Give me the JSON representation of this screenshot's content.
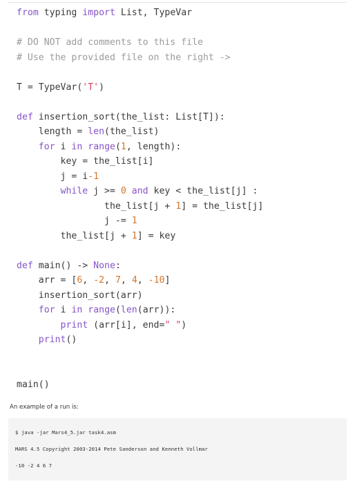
{
  "editor": {
    "language": "python",
    "colors": {
      "background": "#ffffff",
      "text": "#3a3a3a",
      "keyword": "#8554c8",
      "builtin": "#8554c8",
      "string": "#d93b59",
      "number": "#d2752a",
      "comment": "#9b9b9b",
      "rule": "#e3e3e3"
    },
    "lines": [
      [
        {
          "t": "from",
          "c": "kw"
        },
        {
          "t": " typing ",
          "c": "pl"
        },
        {
          "t": "import",
          "c": "kw"
        },
        {
          "t": " List, TypeVar",
          "c": "pl"
        }
      ],
      [],
      [
        {
          "t": "# DO NOT add comments to this file",
          "c": "com"
        }
      ],
      [
        {
          "t": "# Use the provided file on the right ->",
          "c": "com"
        }
      ],
      [],
      [
        {
          "t": "T = TypeVar(",
          "c": "pl"
        },
        {
          "t": "'T'",
          "c": "str"
        },
        {
          "t": ")",
          "c": "pl"
        }
      ],
      [],
      [
        {
          "t": "def",
          "c": "kw"
        },
        {
          "t": " insertion_sort(the_list: List[T]):",
          "c": "pl"
        }
      ],
      [
        {
          "t": "    length = ",
          "c": "pl"
        },
        {
          "t": "len",
          "c": "bi"
        },
        {
          "t": "(the_list)",
          "c": "pl"
        }
      ],
      [
        {
          "t": "    ",
          "c": "pl"
        },
        {
          "t": "for",
          "c": "kw"
        },
        {
          "t": " i ",
          "c": "pl"
        },
        {
          "t": "in",
          "c": "kw"
        },
        {
          "t": " ",
          "c": "pl"
        },
        {
          "t": "range",
          "c": "bi"
        },
        {
          "t": "(",
          "c": "pl"
        },
        {
          "t": "1",
          "c": "num"
        },
        {
          "t": ", length):",
          "c": "pl"
        }
      ],
      [
        {
          "t": "        key = the_list[i]",
          "c": "pl"
        }
      ],
      [
        {
          "t": "        j = i",
          "c": "pl"
        },
        {
          "t": "-1",
          "c": "num"
        }
      ],
      [
        {
          "t": "        ",
          "c": "pl"
        },
        {
          "t": "while",
          "c": "kw"
        },
        {
          "t": " j >= ",
          "c": "pl"
        },
        {
          "t": "0",
          "c": "num"
        },
        {
          "t": " ",
          "c": "pl"
        },
        {
          "t": "and",
          "c": "kw"
        },
        {
          "t": " key < the_list[j] :",
          "c": "pl"
        }
      ],
      [
        {
          "t": "                the_list[j + ",
          "c": "pl"
        },
        {
          "t": "1",
          "c": "num"
        },
        {
          "t": "] = the_list[j]",
          "c": "pl"
        }
      ],
      [
        {
          "t": "                j -= ",
          "c": "pl"
        },
        {
          "t": "1",
          "c": "num"
        }
      ],
      [
        {
          "t": "        the_list[j + ",
          "c": "pl"
        },
        {
          "t": "1",
          "c": "num"
        },
        {
          "t": "] = key",
          "c": "pl"
        }
      ],
      [],
      [
        {
          "t": "def",
          "c": "kw"
        },
        {
          "t": " main() -> ",
          "c": "pl"
        },
        {
          "t": "None",
          "c": "kw"
        },
        {
          "t": ":",
          "c": "pl"
        }
      ],
      [
        {
          "t": "    arr = [",
          "c": "pl"
        },
        {
          "t": "6",
          "c": "num"
        },
        {
          "t": ", ",
          "c": "pl"
        },
        {
          "t": "-2",
          "c": "num"
        },
        {
          "t": ", ",
          "c": "pl"
        },
        {
          "t": "7",
          "c": "num"
        },
        {
          "t": ", ",
          "c": "pl"
        },
        {
          "t": "4",
          "c": "num"
        },
        {
          "t": ", ",
          "c": "pl"
        },
        {
          "t": "-10",
          "c": "num"
        },
        {
          "t": "]",
          "c": "pl"
        }
      ],
      [
        {
          "t": "    insertion_sort(arr)",
          "c": "pl"
        }
      ],
      [
        {
          "t": "    ",
          "c": "pl"
        },
        {
          "t": "for",
          "c": "kw"
        },
        {
          "t": " i ",
          "c": "pl"
        },
        {
          "t": "in",
          "c": "kw"
        },
        {
          "t": " ",
          "c": "pl"
        },
        {
          "t": "range",
          "c": "bi"
        },
        {
          "t": "(",
          "c": "pl"
        },
        {
          "t": "len",
          "c": "bi"
        },
        {
          "t": "(arr)):",
          "c": "pl"
        }
      ],
      [
        {
          "t": "        ",
          "c": "pl"
        },
        {
          "t": "print",
          "c": "bi"
        },
        {
          "t": " (arr[i], end=",
          "c": "pl"
        },
        {
          "t": "\" \"",
          "c": "str"
        },
        {
          "t": ")",
          "c": "pl"
        }
      ],
      [
        {
          "t": "    ",
          "c": "pl"
        },
        {
          "t": "print",
          "c": "bi"
        },
        {
          "t": "()",
          "c": "pl"
        }
      ],
      [],
      [],
      [
        {
          "t": "main()",
          "c": "pl"
        }
      ]
    ]
  },
  "caption": {
    "text": "An example of a run is:"
  },
  "terminal": {
    "background": "#f4f4f4",
    "lines": [
      "$ java -jar Mars4_5.jar task4.asm",
      "MARS 4.5 Copyright 2003-2014 Pete Sanderson and Kenneth Vollmar",
      "-10 -2 4 6 7"
    ]
  }
}
